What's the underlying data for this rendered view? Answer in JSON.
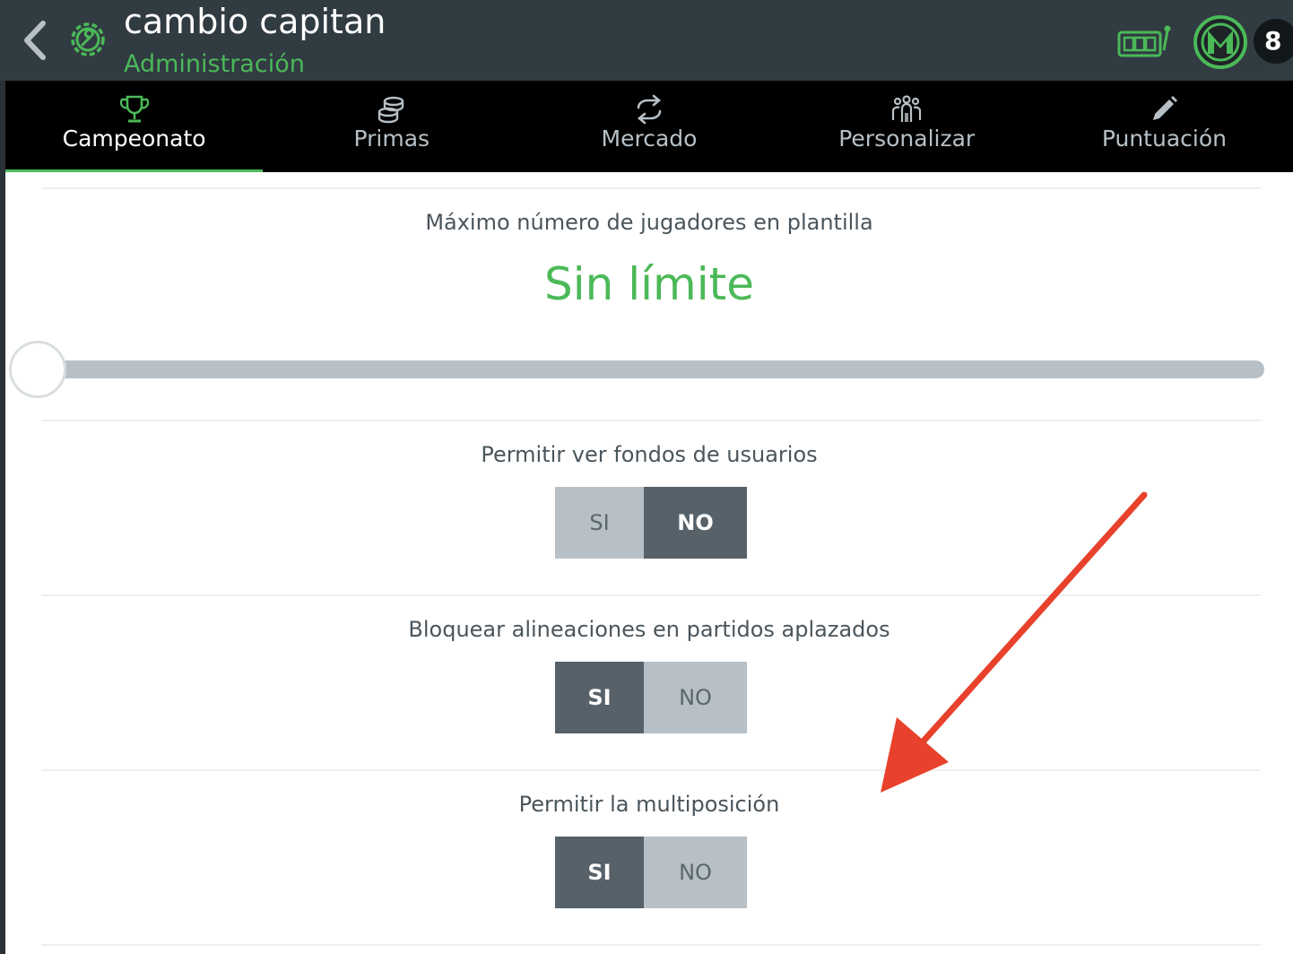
{
  "header": {
    "title": "cambio capitan",
    "subtitle": "Administración",
    "badge_count": "8"
  },
  "tabs": [
    {
      "label": "Campeonato",
      "icon": "trophy-icon",
      "active": true
    },
    {
      "label": "Primas",
      "icon": "coins-icon",
      "active": false
    },
    {
      "label": "Mercado",
      "icon": "transfer-icon",
      "active": false
    },
    {
      "label": "Personalizar",
      "icon": "users-icon",
      "active": false
    },
    {
      "label": "Puntuación",
      "icon": "pencil-icon",
      "active": false
    }
  ],
  "settings": {
    "max_players": {
      "label": "Máximo número de jugadores en plantilla",
      "value": "Sin límite",
      "slider_level": 0
    },
    "view_funds": {
      "label": "Permitir ver fondos de usuarios",
      "si": "SI",
      "no": "NO",
      "selected": "NO"
    },
    "block_lineups": {
      "label": "Bloquear alineaciones en partidos aplazados",
      "si": "SI",
      "no": "NO",
      "selected": "SI"
    },
    "multiposition": {
      "label": "Permitir la multiposición",
      "si": "SI",
      "no": "NO",
      "selected": "SI"
    }
  },
  "colors": {
    "accent": "#4bb958",
    "header_bg": "#313b42",
    "tabbar_bg": "#000000",
    "toggle_on": "#566169",
    "toggle_off": "#b7c0c6",
    "annotation_arrow": "#e8412c"
  }
}
